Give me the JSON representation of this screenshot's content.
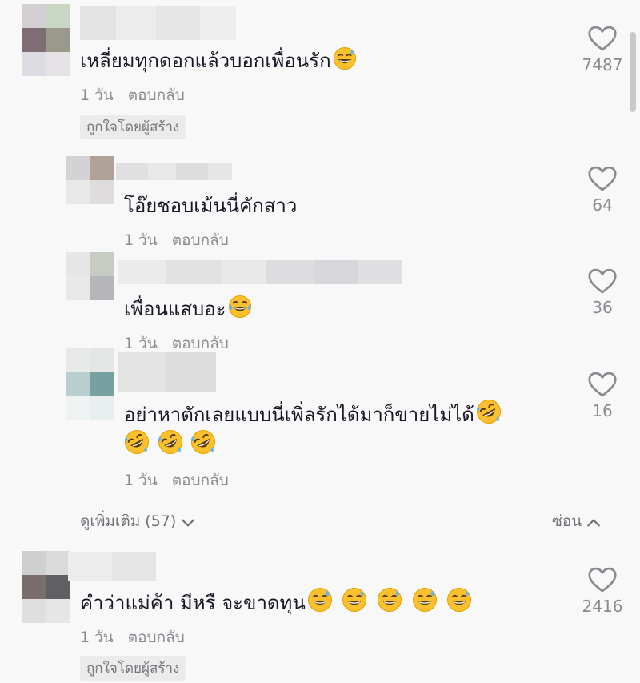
{
  "colors": {
    "background": "#f8f8f8",
    "text": "#161823",
    "meta": "#8a8b91",
    "badge_bg": "#ebebeb",
    "heart_outline": "#8a8b91",
    "emoji_face": "#fbc02d"
  },
  "comments": [
    {
      "text": "เหลี่ยมทุกดอกแล้วบอกเพื่อนรัก",
      "emoji": [
        "sweat-smile-emoji"
      ],
      "time": "1 วัน",
      "reply_label": "ตอบกลับ",
      "badge": "ถูกใจโดยผู้สร้าง",
      "likes": "7487",
      "like_icon": "heart-outline-icon"
    },
    {
      "text": "คำว่าแม่ค้า มีหรื จะขาดทุน",
      "emoji": [
        "sweat-smile-emoji",
        "sweat-smile-emoji",
        "sweat-smile-emoji",
        "sweat-smile-emoji",
        "sweat-smile-emoji"
      ],
      "time": "1 วัน",
      "reply_label": "ตอบกลับ",
      "badge": "ถูกใจโดยผู้สร้าง",
      "likes": "2416",
      "like_icon": "heart-outline-icon"
    }
  ],
  "replies": [
    {
      "text": "โอ๊ยชอบเม้นนี่คักสาว",
      "emoji": [],
      "time": "1 วัน",
      "reply_label": "ตอบกลับ",
      "likes": "64"
    },
    {
      "text": "เพื่อนแสบอะ",
      "emoji": [
        "joy-emoji"
      ],
      "time": "1 วัน",
      "reply_label": "ตอบกลับ",
      "likes": "36"
    },
    {
      "text": "อย่าหาตักเลยแบบนี่เพิ่ลรักได้มาก็ขายไม่ได้",
      "emoji_line1": [
        "rofl-emoji"
      ],
      "emoji_line2": [
        "rofl-emoji",
        "rofl-emoji",
        "rofl-emoji"
      ],
      "time": "1 วัน",
      "reply_label": "ตอบกลับ",
      "likes": "16"
    }
  ],
  "thread_controls": {
    "view_more": "ดูเพิ่มเติม (57)",
    "view_more_icon": "chevron-down-icon",
    "hide": "ซ่อน",
    "hide_icon": "chevron-up-icon"
  }
}
